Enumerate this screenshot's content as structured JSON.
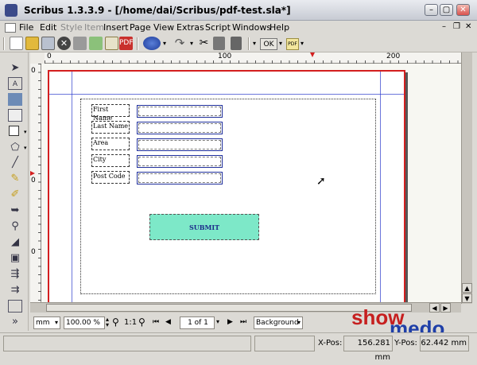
{
  "window": {
    "title": "Scribus 1.3.3.9 - [/home/dai/Scribus/pdf-test.sla*]"
  },
  "menu": {
    "items": [
      "File",
      "Edit",
      "Style",
      "Item",
      "Insert",
      "Page",
      "View",
      "Extras",
      "Script",
      "Windows",
      "Help"
    ]
  },
  "toolbar": {
    "ok_label": "OK"
  },
  "ruler": {
    "h_ticks": [
      "0",
      "100",
      "200"
    ],
    "v_ticks": [
      "0",
      "0",
      "0"
    ]
  },
  "form": {
    "labels": [
      "First Name",
      "Last Name",
      "Area",
      "City",
      "Post Code"
    ],
    "submit_label": "SUBMIT"
  },
  "bottom": {
    "unit": "mm",
    "zoom": "100.00 %",
    "zoom_ratio": "1:1",
    "page_of": "1 of 1",
    "layer": "Background"
  },
  "status": {
    "xpos_label": "X-Pos:",
    "xpos_value": "156.281 mm",
    "ypos_label": "Y-Pos:",
    "ypos_value": "62.442 mm"
  },
  "logo": {
    "part1": "show",
    "part2": "medo"
  },
  "colors": {
    "frame_red": "#d41f1f",
    "guide_blue": "#2c3ccc",
    "submit_fill": "#7de8c8"
  }
}
